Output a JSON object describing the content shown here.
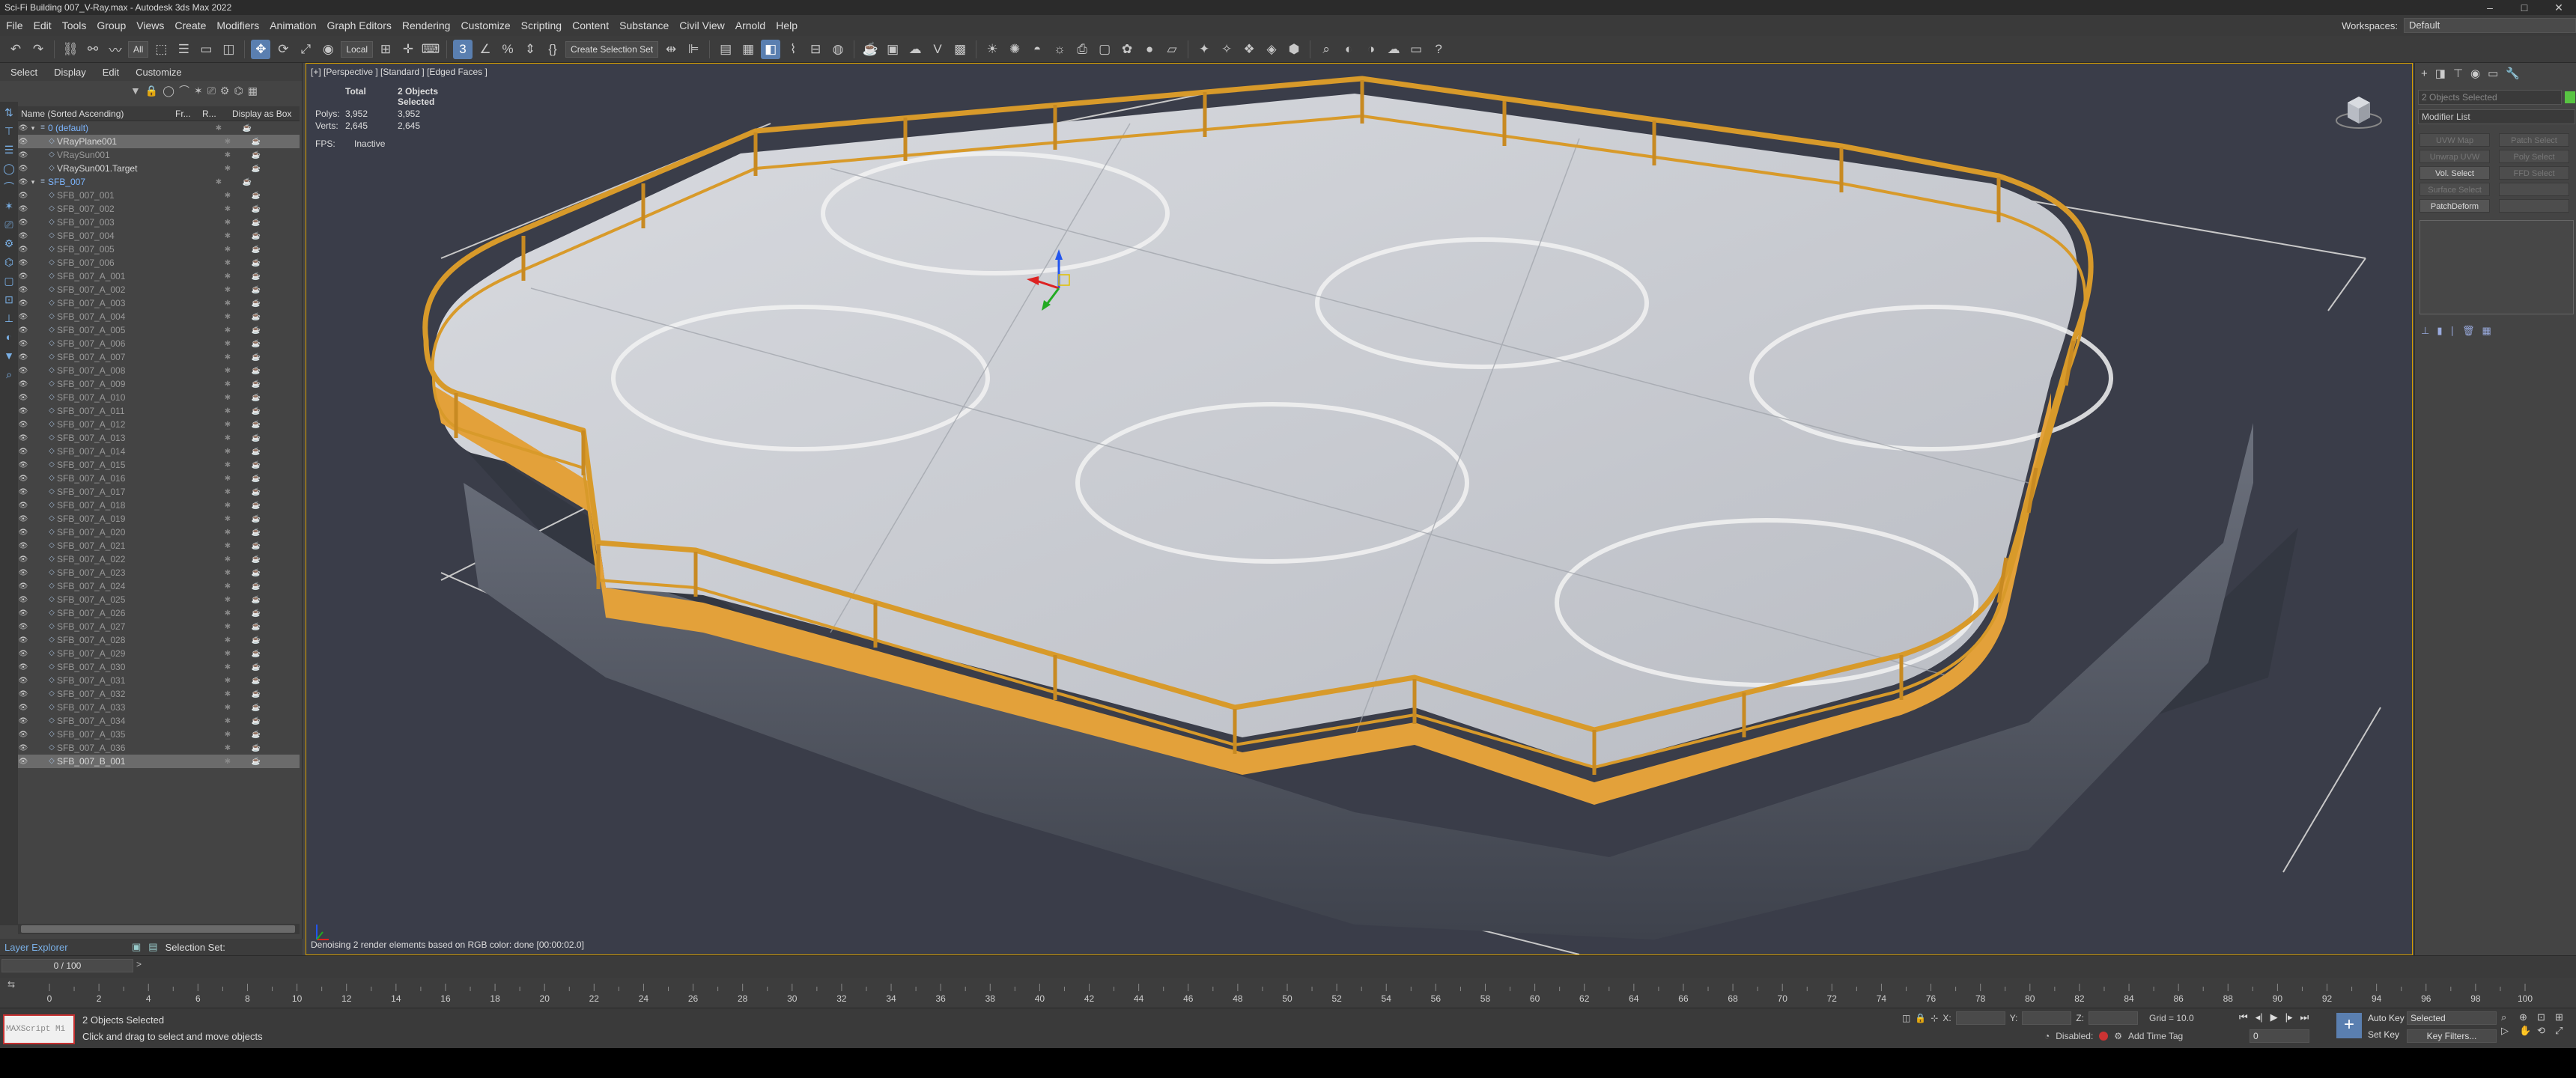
{
  "window": {
    "title": "Sci-Fi Building 007_V-Ray.max - Autodesk 3ds Max 2022",
    "controls": [
      "–",
      "□",
      "✕"
    ]
  },
  "menubar": {
    "items": [
      "File",
      "Edit",
      "Tools",
      "Group",
      "Views",
      "Create",
      "Modifiers",
      "Animation",
      "Graph Editors",
      "Rendering",
      "Customize",
      "Scripting",
      "Content",
      "Substance",
      "Civil View",
      "Arnold",
      "Help"
    ],
    "workspace_label": "Workspaces:",
    "workspace_value": "Default"
  },
  "toolbar": {
    "selection_filter": "All",
    "reference_coord": "Local",
    "named_selection": "Create Selection Set"
  },
  "explorer": {
    "menu": [
      "Select",
      "Display",
      "Edit",
      "Customize"
    ],
    "columns": {
      "name": "Name (Sorted Ascending)",
      "frozen": "Fr...",
      "renderable": "R...",
      "display_box": "Display as Box"
    },
    "rows": [
      {
        "name": "0 (default)",
        "kind": "layer",
        "depth": 0,
        "selected": false
      },
      {
        "name": "VRayPlane001",
        "kind": "obj",
        "depth": 1,
        "selected": true
      },
      {
        "name": "VRaySun001",
        "kind": "dim",
        "depth": 1,
        "selected": false
      },
      {
        "name": "VRaySun001.Target",
        "kind": "obj",
        "depth": 1,
        "selected": false
      },
      {
        "name": "SFB_007",
        "kind": "layer",
        "depth": 0,
        "selected": false
      },
      {
        "name": "SFB_007_001",
        "kind": "dim",
        "depth": 1,
        "selected": false
      },
      {
        "name": "SFB_007_002",
        "kind": "dim",
        "depth": 1,
        "selected": false
      },
      {
        "name": "SFB_007_003",
        "kind": "dim",
        "depth": 1,
        "selected": false
      },
      {
        "name": "SFB_007_004",
        "kind": "dim",
        "depth": 1,
        "selected": false
      },
      {
        "name": "SFB_007_005",
        "kind": "dim",
        "depth": 1,
        "selected": false
      },
      {
        "name": "SFB_007_006",
        "kind": "dim",
        "depth": 1,
        "selected": false
      },
      {
        "name": "SFB_007_A_001",
        "kind": "dim",
        "depth": 1,
        "selected": false
      },
      {
        "name": "SFB_007_A_002",
        "kind": "dim",
        "depth": 1,
        "selected": false
      },
      {
        "name": "SFB_007_A_003",
        "kind": "dim",
        "depth": 1,
        "selected": false
      },
      {
        "name": "SFB_007_A_004",
        "kind": "dim",
        "depth": 1,
        "selected": false
      },
      {
        "name": "SFB_007_A_005",
        "kind": "dim",
        "depth": 1,
        "selected": false
      },
      {
        "name": "SFB_007_A_006",
        "kind": "dim",
        "depth": 1,
        "selected": false
      },
      {
        "name": "SFB_007_A_007",
        "kind": "dim",
        "depth": 1,
        "selected": false
      },
      {
        "name": "SFB_007_A_008",
        "kind": "dim",
        "depth": 1,
        "selected": false
      },
      {
        "name": "SFB_007_A_009",
        "kind": "dim",
        "depth": 1,
        "selected": false
      },
      {
        "name": "SFB_007_A_010",
        "kind": "dim",
        "depth": 1,
        "selected": false
      },
      {
        "name": "SFB_007_A_011",
        "kind": "dim",
        "depth": 1,
        "selected": false
      },
      {
        "name": "SFB_007_A_012",
        "kind": "dim",
        "depth": 1,
        "selected": false
      },
      {
        "name": "SFB_007_A_013",
        "kind": "dim",
        "depth": 1,
        "selected": false
      },
      {
        "name": "SFB_007_A_014",
        "kind": "dim",
        "depth": 1,
        "selected": false
      },
      {
        "name": "SFB_007_A_015",
        "kind": "dim",
        "depth": 1,
        "selected": false
      },
      {
        "name": "SFB_007_A_016",
        "kind": "dim",
        "depth": 1,
        "selected": false
      },
      {
        "name": "SFB_007_A_017",
        "kind": "dim",
        "depth": 1,
        "selected": false
      },
      {
        "name": "SFB_007_A_018",
        "kind": "dim",
        "depth": 1,
        "selected": false
      },
      {
        "name": "SFB_007_A_019",
        "kind": "dim",
        "depth": 1,
        "selected": false
      },
      {
        "name": "SFB_007_A_020",
        "kind": "dim",
        "depth": 1,
        "selected": false
      },
      {
        "name": "SFB_007_A_021",
        "kind": "dim",
        "depth": 1,
        "selected": false
      },
      {
        "name": "SFB_007_A_022",
        "kind": "dim",
        "depth": 1,
        "selected": false
      },
      {
        "name": "SFB_007_A_023",
        "kind": "dim",
        "depth": 1,
        "selected": false
      },
      {
        "name": "SFB_007_A_024",
        "kind": "dim",
        "depth": 1,
        "selected": false
      },
      {
        "name": "SFB_007_A_025",
        "kind": "dim",
        "depth": 1,
        "selected": false
      },
      {
        "name": "SFB_007_A_026",
        "kind": "dim",
        "depth": 1,
        "selected": false
      },
      {
        "name": "SFB_007_A_027",
        "kind": "dim",
        "depth": 1,
        "selected": false
      },
      {
        "name": "SFB_007_A_028",
        "kind": "dim",
        "depth": 1,
        "selected": false
      },
      {
        "name": "SFB_007_A_029",
        "kind": "dim",
        "depth": 1,
        "selected": false
      },
      {
        "name": "SFB_007_A_030",
        "kind": "dim",
        "depth": 1,
        "selected": false
      },
      {
        "name": "SFB_007_A_031",
        "kind": "dim",
        "depth": 1,
        "selected": false
      },
      {
        "name": "SFB_007_A_032",
        "kind": "dim",
        "depth": 1,
        "selected": false
      },
      {
        "name": "SFB_007_A_033",
        "kind": "dim",
        "depth": 1,
        "selected": false
      },
      {
        "name": "SFB_007_A_034",
        "kind": "dim",
        "depth": 1,
        "selected": false
      },
      {
        "name": "SFB_007_A_035",
        "kind": "dim",
        "depth": 1,
        "selected": false
      },
      {
        "name": "SFB_007_A_036",
        "kind": "dim",
        "depth": 1,
        "selected": false
      },
      {
        "name": "SFB_007_B_001",
        "kind": "obj",
        "depth": 1,
        "selected": true
      }
    ],
    "footer_title": "Layer Explorer",
    "footer_set": "Selection Set:"
  },
  "viewport": {
    "label": "[+] [Perspective ] [Standard ] [Edged Faces ]",
    "stats": {
      "total_label": "Total",
      "selected_label": "2 Objects Selected",
      "polys_label": "Polys:",
      "polys_total": "3,952",
      "polys_selected": "3,952",
      "verts_label": "Verts:",
      "verts_total": "2,645",
      "verts_selected": "2,645"
    },
    "fps_label": "FPS:",
    "fps_value": "Inactive",
    "status": "Denoising 2 render elements based on RGB color: done [00:00:02.0]"
  },
  "command_panel": {
    "name_field": "2 Objects Selected",
    "object_color": "#58c442",
    "modifier_list": "Modifier List",
    "buttons": [
      {
        "label": "UVW Map",
        "on": false
      },
      {
        "label": "Patch Select",
        "on": false
      },
      {
        "label": "Unwrap UVW",
        "on": false
      },
      {
        "label": "Poly Select",
        "on": false
      },
      {
        "label": "Vol. Select",
        "on": true
      },
      {
        "label": "FFD Select",
        "on": false
      },
      {
        "label": "Surface Select",
        "on": false
      },
      {
        "label": "",
        "on": false
      },
      {
        "label": "PatchDeform",
        "on": true
      },
      {
        "label": "",
        "on": false
      }
    ]
  },
  "timeline": {
    "frame_display": "0 / 100",
    "ticks": [
      "0",
      "2",
      "4",
      "6",
      "8",
      "10",
      "12",
      "14",
      "16",
      "18",
      "20",
      "22",
      "24",
      "26",
      "28",
      "30",
      "32",
      "34",
      "36",
      "38",
      "40",
      "42",
      "44",
      "46",
      "48",
      "50",
      "52",
      "54",
      "56",
      "58",
      "60",
      "62",
      "64",
      "66",
      "68",
      "70",
      "72",
      "74",
      "76",
      "78",
      "80",
      "82",
      "84",
      "86",
      "88",
      "90",
      "92",
      "94",
      "96",
      "98",
      "100"
    ]
  },
  "statusbar": {
    "maxscript": "MAXScript Mi",
    "selection": "2 Objects Selected",
    "hint": "Click and drag to select and move objects",
    "x_label": "X:",
    "y_label": "Y:",
    "z_label": "Z:",
    "grid": "Grid = 10.0",
    "disabled": "Disabled:",
    "add_time_tag": "Add Time Tag",
    "auto_key": "Auto Key",
    "set_key": "Set Key",
    "selected_dropdown": "Selected",
    "key_filters": "Key Filters...",
    "frame_value": "0"
  },
  "colors": {
    "viewport_bg": "#3a3d49",
    "active_border": "#d8a000",
    "railing": "#d99a2b",
    "floor": "#cfd1d6",
    "accent": "#5a7fb0"
  }
}
